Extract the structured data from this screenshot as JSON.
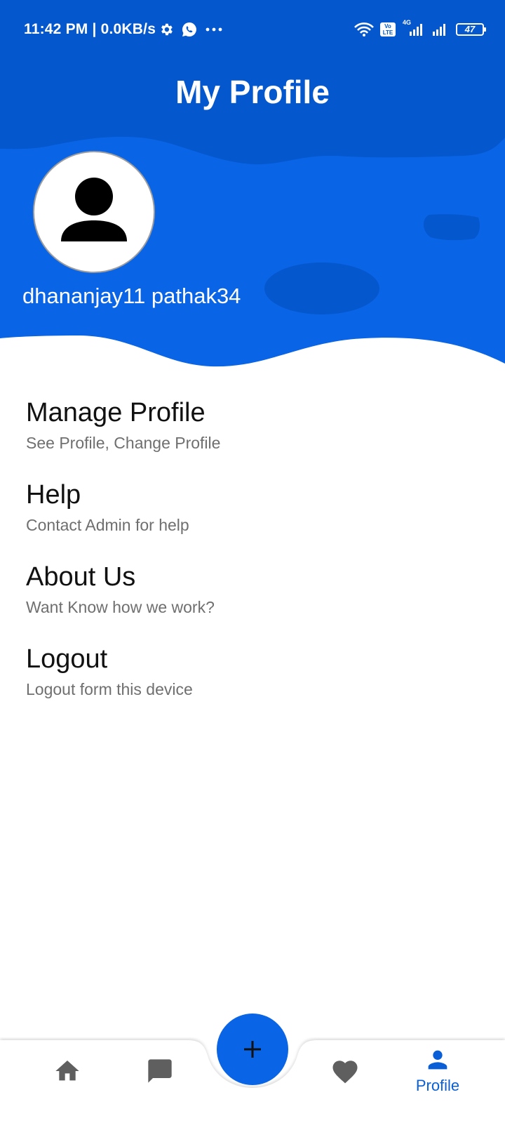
{
  "status_bar": {
    "time": "11:42 PM | 0.0KB/s",
    "volte": "Vo LTE",
    "network": "4G",
    "battery": "47"
  },
  "header": {
    "title": "My Profile",
    "user_name": "dhananjay11 pathak34"
  },
  "menu": {
    "items": [
      {
        "title": "Manage Profile",
        "subtitle": "See Profile, Change Profile"
      },
      {
        "title": "Help",
        "subtitle": "Contact Admin for help"
      },
      {
        "title": "About Us",
        "subtitle": "Want Know how we work?"
      },
      {
        "title": "Logout",
        "subtitle": "Logout form this device"
      }
    ]
  },
  "bottom_nav": {
    "items": [
      {
        "icon": "home-icon",
        "label": ""
      },
      {
        "icon": "chat-icon",
        "label": ""
      },
      {
        "icon": "add-icon",
        "label": ""
      },
      {
        "icon": "heart-icon",
        "label": ""
      },
      {
        "icon": "person-icon",
        "label": "Profile"
      }
    ],
    "active": "Profile"
  },
  "colors": {
    "primary": "#0a64e6",
    "header_dark": "#0457cc",
    "icon_inactive": "#5f5f5f"
  }
}
